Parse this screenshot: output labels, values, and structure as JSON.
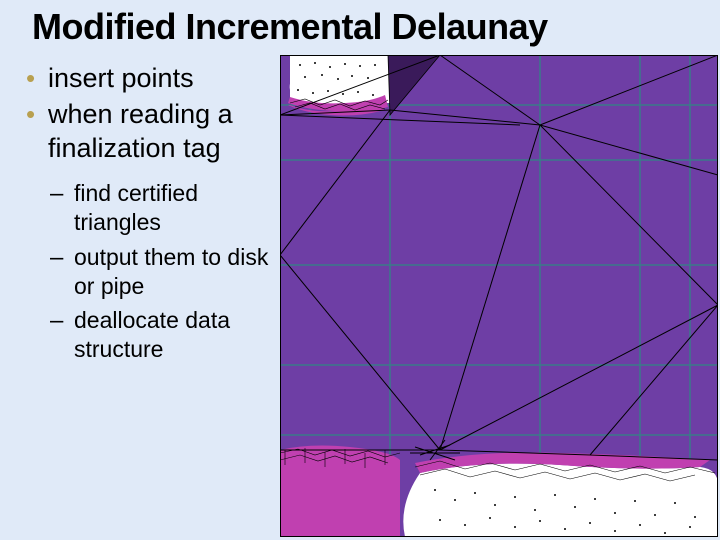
{
  "title": "Modified Incremental Delaunay",
  "bullets": {
    "l1": [
      "insert points",
      "when reading a finalization tag"
    ],
    "l2": [
      "find certified triangles",
      "output them to disk or pipe",
      "deallocate data structure"
    ]
  },
  "figure": {
    "description": "delaunay-triangulation-visualization",
    "colors": {
      "bg": "#6e3ea5",
      "grid": "#3a7a8a",
      "mesh": "#000000",
      "dense": "#ffffff",
      "magenta": "#c040b0",
      "darkfill": "#3a1a5a"
    }
  }
}
